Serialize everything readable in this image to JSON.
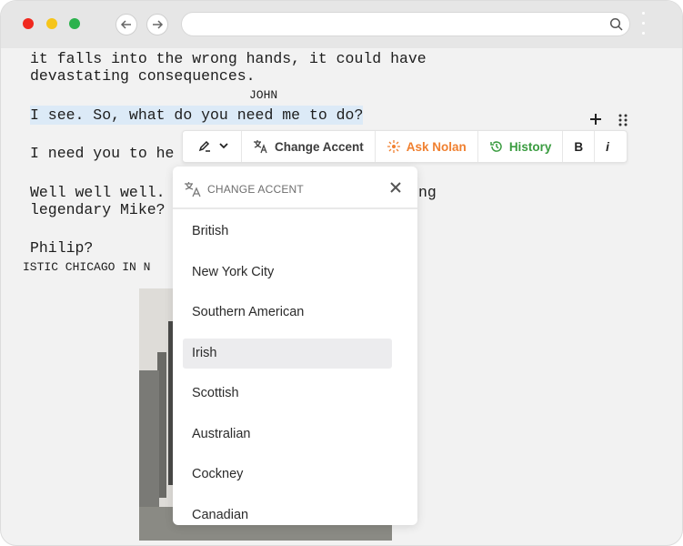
{
  "browser": {
    "url": "",
    "back_icon": "arrow-left-icon",
    "forward_icon": "arrow-right-icon",
    "search_icon": "search-icon"
  },
  "script": {
    "lines": [
      "it falls into the wrong hands, it could have",
      "devastating consequences.",
      "JOHN",
      "I see. So, what do you need me to do?",
      "I need you to he",
      "Well well well.",
      "ng",
      "legendary Mike?",
      "Philip?",
      "ISTIC CHICAGO IN N"
    ]
  },
  "toolbar": {
    "pen_icon": "pen-icon",
    "change_accent_label": "Change Accent",
    "ask_nolan_label": "Ask Nolan",
    "history_label": "History",
    "bold_label": "B",
    "italic_label": "i"
  },
  "dropdown": {
    "title": "CHANGE ACCENT",
    "items": [
      {
        "label": "British",
        "selected": false
      },
      {
        "label": "New York City",
        "selected": false
      },
      {
        "label": "Southern American",
        "selected": false
      },
      {
        "label": "Irish",
        "selected": true
      },
      {
        "label": "Scottish",
        "selected": false
      },
      {
        "label": "Australian",
        "selected": false
      },
      {
        "label": "Cockney",
        "selected": false
      },
      {
        "label": "Canadian",
        "selected": false
      }
    ]
  },
  "colors": {
    "highlight": "#dceaf7",
    "ask_nolan": "#f08030",
    "history": "#3a9c40",
    "selected_item": "#ececee"
  }
}
